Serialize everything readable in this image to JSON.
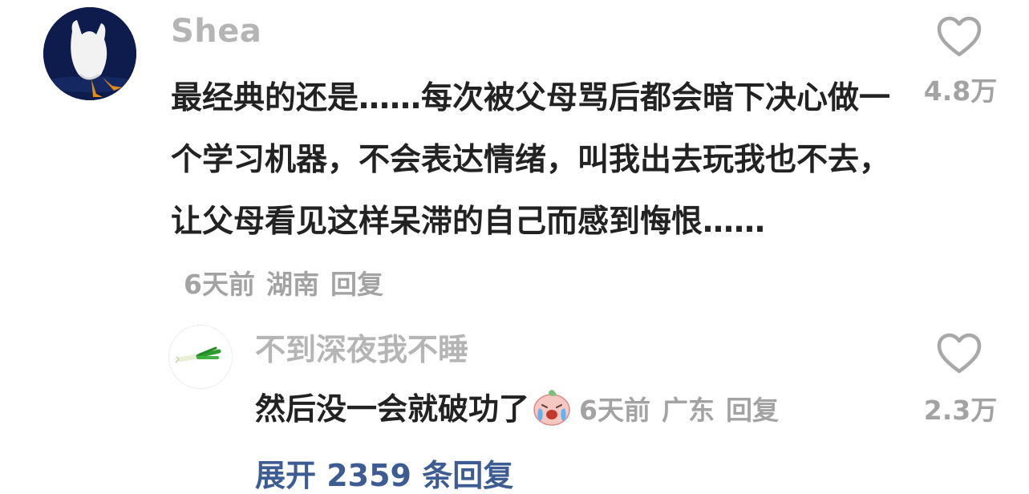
{
  "comment": {
    "username": "Shea",
    "text": "最经典的还是……每次被父母骂后都会暗下决心做一个学习机器，不会表达情绪，叫我出去玩我也不去，让父母看见这样呆滞的自己而感到悔恨……",
    "time": "6天前",
    "location": "湖南",
    "reply_label": "回复",
    "like_count": "4.8万",
    "avatar_icon": "duck-diving-icon",
    "like_icon": "heart-outline-icon"
  },
  "reply": {
    "username": "不到深夜我不睡",
    "text": "然后没一会就破功了",
    "emoji_icon": "crying-face-emoji-icon",
    "time": "6天前",
    "location": "广东",
    "reply_label": "回复",
    "like_count": "2.3万",
    "avatar_icon": "green-onion-icon",
    "like_icon": "heart-outline-icon"
  },
  "expand_link": "展开 2359 条回复",
  "colors": {
    "text_primary": "#222222",
    "text_meta": "#a3a3a3",
    "username": "#b5b5b5",
    "link": "#3d5c94"
  }
}
